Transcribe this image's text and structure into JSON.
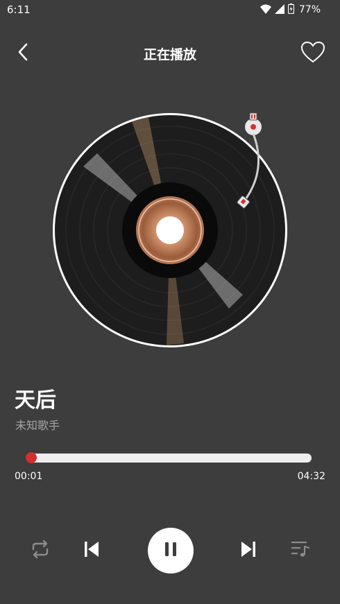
{
  "status_bar": {
    "time": "6:11",
    "battery_percent": "77%"
  },
  "header": {
    "title": "正在播放"
  },
  "song": {
    "title": "天后",
    "artist": "未知歌手"
  },
  "playback": {
    "elapsed": "00:01",
    "total": "04:32",
    "progress_fraction": 0.004,
    "state": "playing"
  },
  "colors": {
    "background": "#3d3d3d",
    "accent": "#d32f2f",
    "text_secondary": "#a5a5a5"
  },
  "icons": {
    "back": "chevron-left-icon",
    "favorite": "heart-outline-icon",
    "repeat": "repeat-icon",
    "previous": "skip-previous-icon",
    "pause": "pause-icon",
    "next": "skip-next-icon",
    "playlist": "playlist-music-icon"
  }
}
